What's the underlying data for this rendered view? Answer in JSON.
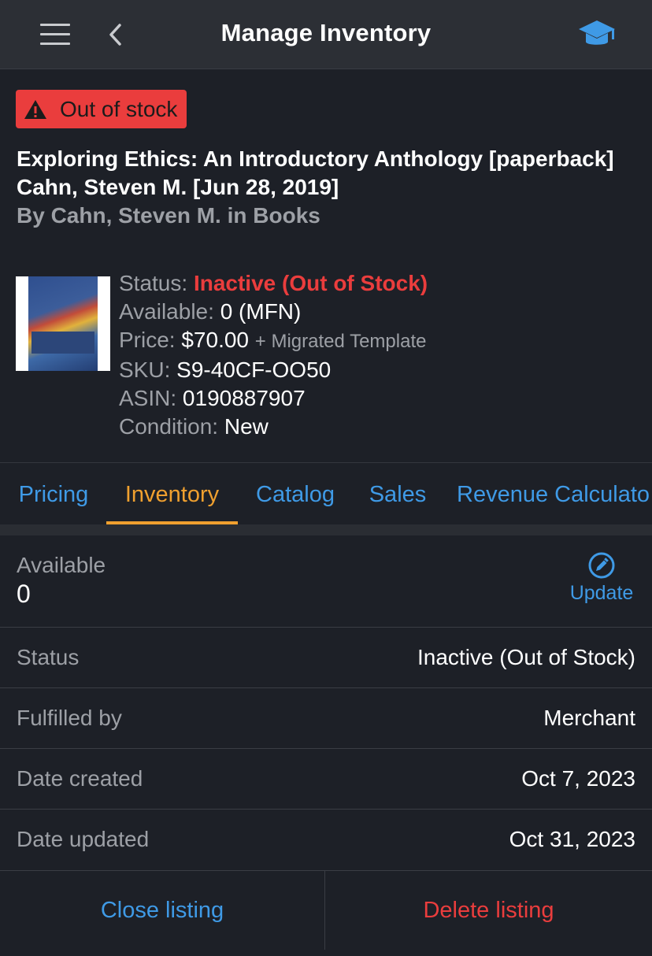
{
  "header": {
    "title": "Manage Inventory",
    "menu_icon": "hamburger-menu-icon",
    "back_icon": "chevron-left-icon",
    "help_icon": "graduation-cap-icon"
  },
  "product": {
    "badge": "Out of stock",
    "title": "Exploring Ethics: An Introductory Anthology [paperback] Cahn, Steven M. [Jun 28, 2019]",
    "byline": "By Cahn, Steven M. in Books",
    "status_label": "Status:",
    "status_value": "Inactive (Out of Stock)",
    "available_label": "Available:",
    "available_value": "0 (MFN)",
    "price_label": "Price:",
    "price_value": "$70.00",
    "price_note": "+ Migrated Template",
    "sku_label": "SKU:",
    "sku_value": "S9-40CF-OO50",
    "asin_label": "ASIN:",
    "asin_value": "0190887907",
    "condition_label": "Condition:",
    "condition_value": "New"
  },
  "tabs": [
    "Pricing",
    "Inventory",
    "Catalog",
    "Sales",
    "Revenue Calculato"
  ],
  "active_tab": "Inventory",
  "inventory": {
    "available_label": "Available",
    "available_value": "0",
    "update_label": "Update",
    "rows": [
      {
        "label": "Status",
        "value": "Inactive (Out of Stock)"
      },
      {
        "label": "Fulfilled by",
        "value": "Merchant"
      },
      {
        "label": "Date created",
        "value": "Oct 7, 2023"
      },
      {
        "label": "Date updated",
        "value": "Oct 31, 2023"
      }
    ]
  },
  "actions": {
    "close_label": "Close listing",
    "delete_label": "Delete listing"
  },
  "colors": {
    "accent_blue": "#3f9ae6",
    "accent_orange": "#f0a02f",
    "alert_red": "#ea3d3d",
    "background": "#1d2027",
    "header_bg": "#2c2f35"
  }
}
